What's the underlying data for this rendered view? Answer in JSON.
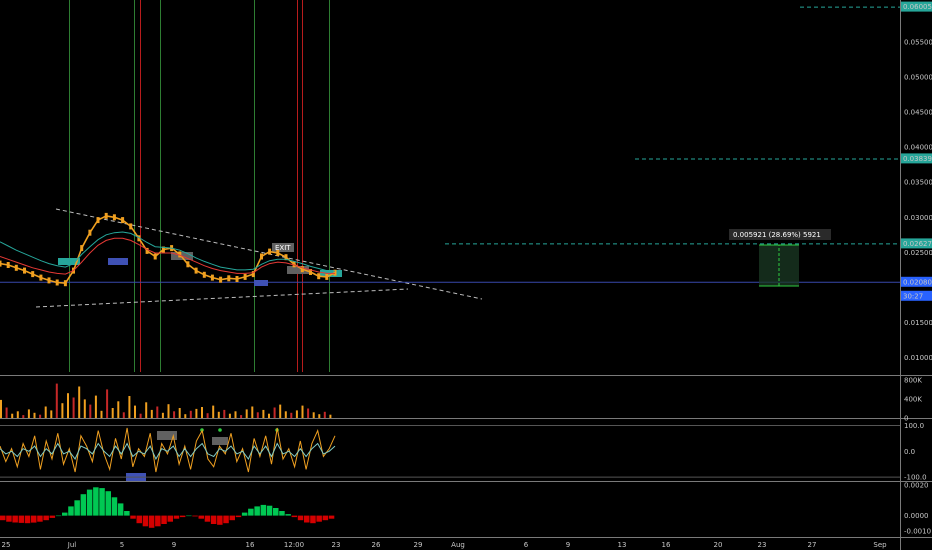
{
  "chart_data": [
    {
      "type": "line",
      "panel": "price",
      "y_scale": "linear",
      "ylim": [
        0.0075,
        0.061
      ],
      "y_ticks": [
        "0.055000",
        "0.050000",
        "0.045000",
        "0.040000",
        "0.035000",
        "0.030000",
        "0.025000",
        "0.015000",
        "0.010000"
      ],
      "x_ticks": [
        "25",
        "Jul",
        "5",
        "9",
        "16",
        "12:00",
        "23",
        "26",
        "29",
        "Aug",
        "6",
        "9",
        "13",
        "16",
        "20",
        "23",
        "27",
        "Sep"
      ],
      "price_tags": [
        {
          "text": "0.060055",
          "value": 0.060055,
          "color": "#26a69a"
        },
        {
          "text": "0.038395",
          "value": 0.038395,
          "color": "#26a69a"
        },
        {
          "text": "0.026272",
          "value": 0.026272,
          "color": "#26a69a"
        },
        {
          "text": "0.020800",
          "value": 0.0208,
          "color": "#2962ff"
        },
        {
          "text": "30:27",
          "value": 0.0188,
          "color": "#2962ff"
        }
      ],
      "hlines": [
        0.060055,
        0.038395,
        0.026272,
        0.0208
      ],
      "measure_label": "0.005921 (28.69%) 5921",
      "measure_from": 0.0208,
      "measure_to": 0.026272,
      "annotations": [
        "EXIT"
      ],
      "series": [
        {
          "values": [
            0.0234,
            0.0232,
            0.0228,
            0.0224,
            0.0219,
            0.0214,
            0.021,
            0.0207,
            0.0206,
            0.0224,
            0.0256,
            0.0278,
            0.0296,
            0.0302,
            0.03,
            0.0296,
            0.0287,
            0.027,
            0.0252,
            0.0244,
            0.0254,
            0.0256,
            0.0247,
            0.0233,
            0.0224,
            0.0218,
            0.0214,
            0.0211,
            0.0213,
            0.0212,
            0.0215,
            0.0219,
            0.0244,
            0.0251,
            0.0249,
            0.0243,
            0.0233,
            0.0226,
            0.0222,
            0.0216,
            0.0215,
            0.0221
          ],
          "color": "#f0a020"
        },
        {
          "values": [
            0.0265,
            0.0259,
            0.0253,
            0.0248,
            0.0243,
            0.0238,
            0.0234,
            0.0231,
            0.0229,
            0.0234,
            0.0247,
            0.0258,
            0.0268,
            0.0275,
            0.0278,
            0.0279,
            0.0277,
            0.0271,
            0.0264,
            0.0258,
            0.0257,
            0.0256,
            0.0253,
            0.0248,
            0.0242,
            0.0237,
            0.0233,
            0.0229,
            0.0227,
            0.0225,
            0.0225,
            0.0226,
            0.0233,
            0.0238,
            0.024,
            0.024,
            0.0237,
            0.0234,
            0.023,
            0.0227,
            0.0224,
            0.0223
          ],
          "color": "#26a69a"
        },
        {
          "values": [
            0.0244,
            0.024,
            0.0236,
            0.0232,
            0.0228,
            0.0225,
            0.0222,
            0.022,
            0.0219,
            0.0224,
            0.0236,
            0.0249,
            0.026,
            0.0267,
            0.027,
            0.027,
            0.0267,
            0.0261,
            0.0254,
            0.0249,
            0.0249,
            0.0249,
            0.0246,
            0.0241,
            0.0236,
            0.0231,
            0.0227,
            0.0224,
            0.0222,
            0.022,
            0.022,
            0.0221,
            0.0229,
            0.0234,
            0.0236,
            0.0235,
            0.0232,
            0.0228,
            0.0225,
            0.0222,
            0.022,
            0.022
          ],
          "color": "#e53935"
        }
      ]
    },
    {
      "type": "bar",
      "panel": "volume",
      "ylim": [
        0,
        880000
      ],
      "y_ticks": [
        "800K",
        "400K",
        "0"
      ],
      "values": [
        380000,
        220000,
        90000,
        140000,
        60000,
        180000,
        110000,
        70000,
        240000,
        160000,
        720000,
        310000,
        520000,
        430000,
        660000,
        390000,
        280000,
        470000,
        150000,
        600000,
        210000,
        350000,
        120000,
        460000,
        260000,
        90000,
        330000,
        170000,
        240000,
        110000,
        290000,
        140000,
        210000,
        80000,
        150000,
        190000,
        230000,
        100000,
        260000,
        130000,
        170000,
        90000,
        140000,
        60000,
        180000,
        240000,
        120000,
        170000,
        90000,
        220000,
        280000,
        140000,
        110000,
        160000,
        260000,
        200000,
        120000,
        80000,
        130000,
        70000
      ]
    },
    {
      "type": "line",
      "panel": "oscillator",
      "ylim": [
        -115,
        125
      ],
      "y_ticks": [
        "100.0",
        "0.0",
        "-100.0"
      ],
      "series": [
        {
          "values": [
            20,
            -40,
            10,
            -60,
            30,
            -20,
            60,
            -70,
            40,
            -30,
            70,
            -50,
            10,
            -80,
            60,
            20,
            -40,
            80,
            -10,
            -70,
            50,
            -30,
            90,
            -60,
            10,
            -20,
            70,
            -80,
            30,
            -10,
            60,
            -50,
            20,
            -70,
            40,
            80,
            -30,
            -60,
            20,
            -10,
            70,
            -40,
            10,
            -80,
            50,
            -20,
            60,
            -50,
            90,
            -30,
            10,
            -60,
            40,
            -70,
            30,
            80,
            -20,
            10,
            60
          ],
          "color": "#f0a020"
        },
        {
          "values": [
            10,
            -10,
            0,
            -20,
            10,
            0,
            20,
            -20,
            10,
            -10,
            30,
            -10,
            0,
            -30,
            20,
            10,
            -10,
            30,
            0,
            -20,
            20,
            -10,
            30,
            -20,
            0,
            -10,
            20,
            -30,
            10,
            0,
            20,
            -20,
            10,
            -20,
            10,
            30,
            -10,
            -20,
            10,
            0,
            20,
            -10,
            0,
            -30,
            20,
            -10,
            20,
            -20,
            30,
            -10,
            0,
            -20,
            10,
            -20,
            10,
            30,
            -10,
            0,
            20
          ],
          "color": "#80cbc4"
        }
      ]
    },
    {
      "type": "bar",
      "panel": "histogram",
      "ylim": [
        -0.0014,
        0.0022
      ],
      "y_ticks": [
        "0.0020",
        "0.0000",
        "-0.0010"
      ],
      "values": [
        -0.0003,
        -0.0004,
        -0.00045,
        -0.00048,
        -0.0005,
        -0.00046,
        -0.0004,
        -0.0003,
        -0.00015,
        0.0,
        0.0002,
        0.0006,
        0.001,
        0.0014,
        0.0017,
        0.00185,
        0.0018,
        0.0016,
        0.0012,
        0.0008,
        0.0003,
        -0.0002,
        -0.0005,
        -0.0007,
        -0.0008,
        -0.0007,
        -0.00055,
        -0.0004,
        -0.0002,
        -0.0001,
        0.0,
        -5e-05,
        -0.0002,
        -0.0004,
        -0.00055,
        -0.0006,
        -0.0005,
        -0.0003,
        -0.0001,
        0.0002,
        0.00045,
        0.0006,
        0.0007,
        0.00065,
        0.0005,
        0.0003,
        0.0001,
        -0.0001,
        -0.0003,
        -0.00045,
        -0.0005,
        -0.0004,
        -0.0003,
        -0.0002
      ]
    }
  ]
}
